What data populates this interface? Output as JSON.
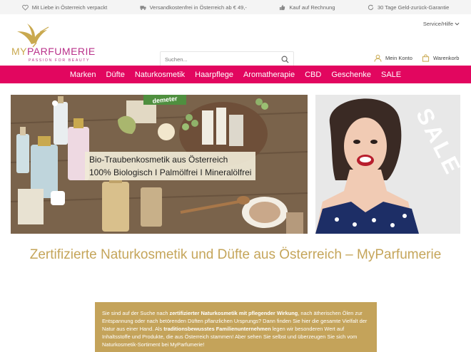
{
  "usp": [
    {
      "icon": "heart-icon",
      "text": "Mit Liebe in Österreich verpackt"
    },
    {
      "icon": "truck-icon",
      "text": "Versandkostenfrei in Österreich ab € 49,-"
    },
    {
      "icon": "thumbs-up-icon",
      "text": "Kauf auf Rechnung"
    },
    {
      "icon": "refresh-icon",
      "text": "30 Tage Geld-zurück-Garantie"
    }
  ],
  "logo": {
    "my": "MY",
    "parfumerie": "PARFUMERIE",
    "tagline": "PASSION FOR BEAUTY"
  },
  "header": {
    "service": "Service/Hilfe",
    "search_placeholder": "Suchen...",
    "account": "Mein Konto",
    "cart": "Warenkorb"
  },
  "nav": [
    "Marken",
    "Düfte",
    "Naturkosmetik",
    "Haarpflege",
    "Aromatherapie",
    "CBD",
    "Geschenke",
    "SALE"
  ],
  "banner_main": {
    "line1": "Bio-Traubenkosmetik aus Österreich",
    "line2": "100% Biologisch I Palmölfrei I Mineralölfrei",
    "badge": "demeter"
  },
  "banner_side": {
    "text": "SALE"
  },
  "headline": "Zertifizierte Naturkosmetik und Düfte aus Österreich – MyParfumerie",
  "intro": {
    "p1": "Sie sind auf der Suche nach ",
    "b1": "zertifizierter Naturkosmetik mit pflegender Wirkung",
    "p2": ", nach ätherischen Ölen zur Entspannung oder nach betörenden Düften pflanzlichen Ursprungs? Dann finden Sie hier die gesamte Vielfalt der Natur aus einer Hand. Als ",
    "b2": "traditionsbewusstes Familienunternehmen",
    "p3": " legen wir besonderen Wert auf Inhaltsstoffe und Produkte, die aus Österreich stammen! Aber sehen Sie selbst und überzeugen Sie sich vom Naturkosmetik-Sortiment bei MyParfumerie!"
  },
  "colors": {
    "accent": "#e2065f",
    "gold": "#c4a35a",
    "brand_pink": "#b9308a"
  }
}
